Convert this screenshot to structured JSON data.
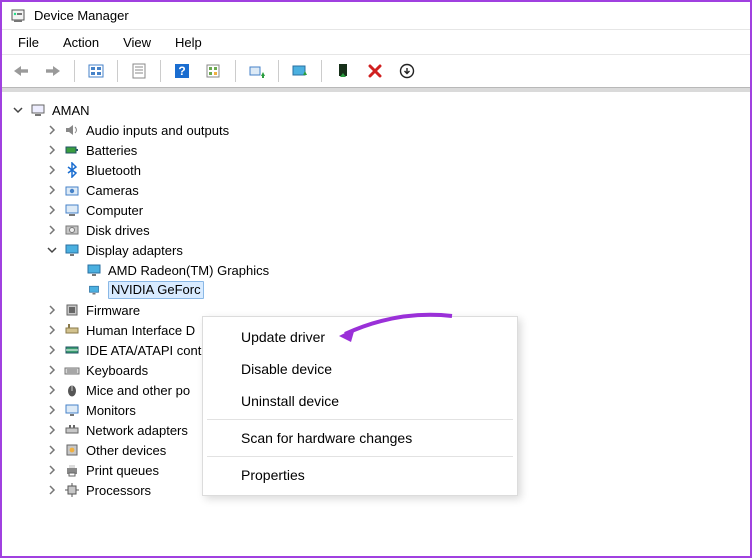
{
  "window": {
    "title": "Device Manager"
  },
  "menu": {
    "file": "File",
    "action": "Action",
    "view": "View",
    "help": "Help"
  },
  "toolbar_names": {
    "back": "back",
    "forward": "forward",
    "show_hidden": "show-hidden",
    "properties": "properties",
    "help": "help",
    "rescan": "scan-hardware",
    "update_driver": "update-driver",
    "uninstall": "uninstall",
    "enable": "enable",
    "disable": "disable",
    "options": "options"
  },
  "root": {
    "label": "AMAN"
  },
  "tree": [
    {
      "type": "category",
      "label": "Audio inputs and outputs",
      "icon": "speaker",
      "expanded": false
    },
    {
      "type": "category",
      "label": "Batteries",
      "icon": "battery",
      "expanded": false
    },
    {
      "type": "category",
      "label": "Bluetooth",
      "icon": "bluetooth",
      "expanded": false
    },
    {
      "type": "category",
      "label": "Cameras",
      "icon": "camera",
      "expanded": false
    },
    {
      "type": "category",
      "label": "Computer",
      "icon": "computer",
      "expanded": false
    },
    {
      "type": "category",
      "label": "Disk drives",
      "icon": "disk",
      "expanded": false
    },
    {
      "type": "category",
      "label": "Display adapters",
      "icon": "display",
      "expanded": true,
      "children": [
        {
          "label": "AMD Radeon(TM) Graphics",
          "icon": "display",
          "selected": false
        },
        {
          "label": "NVIDIA GeForc",
          "icon": "display",
          "selected": true
        }
      ]
    },
    {
      "type": "category",
      "label": "Firmware",
      "icon": "firmware",
      "expanded": false
    },
    {
      "type": "category",
      "label": "Human Interface D",
      "icon": "hid",
      "expanded": false
    },
    {
      "type": "category",
      "label": "IDE ATA/ATAPI cont",
      "icon": "ide",
      "expanded": false
    },
    {
      "type": "category",
      "label": "Keyboards",
      "icon": "keyboard",
      "expanded": false
    },
    {
      "type": "category",
      "label": "Mice and other po",
      "icon": "mouse",
      "expanded": false
    },
    {
      "type": "category",
      "label": "Monitors",
      "icon": "monitor",
      "expanded": false
    },
    {
      "type": "category",
      "label": "Network adapters",
      "icon": "network",
      "expanded": false
    },
    {
      "type": "category",
      "label": "Other devices",
      "icon": "other",
      "expanded": false
    },
    {
      "type": "category",
      "label": "Print queues",
      "icon": "printer",
      "expanded": false
    },
    {
      "type": "category",
      "label": "Processors",
      "icon": "cpu",
      "expanded": false
    }
  ],
  "context_menu": {
    "update": "Update driver",
    "disable": "Disable device",
    "uninstall": "Uninstall device",
    "scan": "Scan for hardware changes",
    "properties": "Properties"
  },
  "annotation": {
    "target": "update-driver"
  }
}
